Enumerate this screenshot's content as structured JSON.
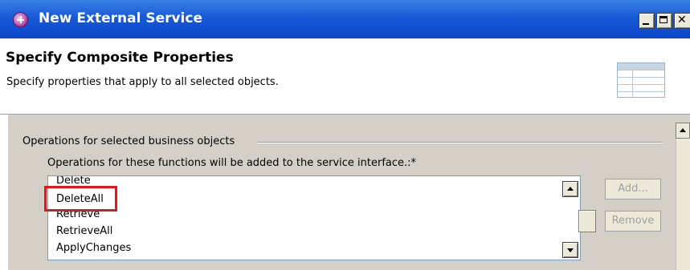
{
  "window": {
    "title": "New External Service",
    "controls": [
      "minimize",
      "maximize",
      "close"
    ]
  },
  "header": {
    "title": "Specify Composite Properties",
    "description": "Specify properties that apply to all selected objects.",
    "image_icon": "table-wizard-icon"
  },
  "group": {
    "label": "Operations for selected business objects"
  },
  "operations": {
    "label": "Operations for these functions will be added to the service interface.:*",
    "items": [
      "Delete",
      "DeleteAll",
      "Retrieve",
      "RetrieveAll",
      "ApplyChanges"
    ],
    "highlighted_item": "DeleteAll",
    "highlight_color": "#e0191e"
  },
  "buttons": {
    "add_label": "Add...",
    "remove_label": "Remove"
  }
}
